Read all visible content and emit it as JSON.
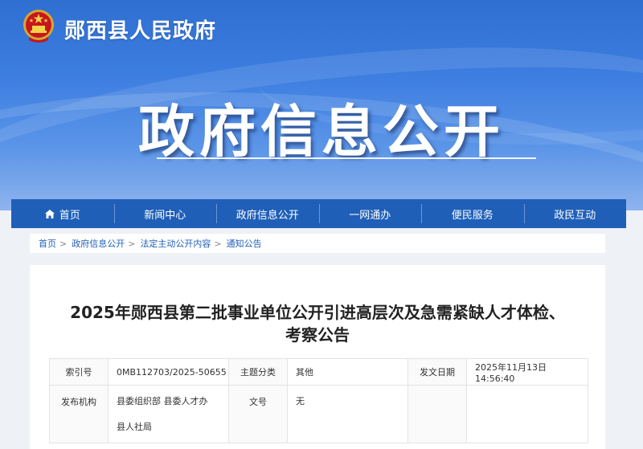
{
  "header": {
    "site_name": "郧西县人民政府",
    "hero_title": "政府信息公开"
  },
  "nav": {
    "items": [
      {
        "label": "首页",
        "icon": "home-icon"
      },
      {
        "label": "新闻中心"
      },
      {
        "label": "政府信息公开"
      },
      {
        "label": "一网通办"
      },
      {
        "label": "便民服务"
      },
      {
        "label": "政民互动"
      }
    ]
  },
  "breadcrumb": {
    "items": [
      "首页",
      "政府信息公开",
      "法定主动公开内容",
      "通知公告"
    ],
    "separator": ">"
  },
  "article": {
    "title_line1": "2025年郧西县第二批事业单位公开引进高层次及急需紧缺人才体检、",
    "title_line2": "考察公告"
  },
  "meta": {
    "index_label": "索引号",
    "index_value": "0MB112703/2025-50655",
    "topic_label": "主题分类",
    "topic_value": "其他",
    "date_label": "发文日期",
    "date_value": "2025年11月13日 14:56:40",
    "publisher_label": "发布机构",
    "publisher_line1": "县委组织部 县委人才办",
    "publisher_line2": "县人社局",
    "docno_label": "文号",
    "docno_value": "无"
  },
  "colors": {
    "nav_bg": "#1f5fb8",
    "banner_blue": "#3c7de0",
    "link": "#1f5fb8"
  }
}
